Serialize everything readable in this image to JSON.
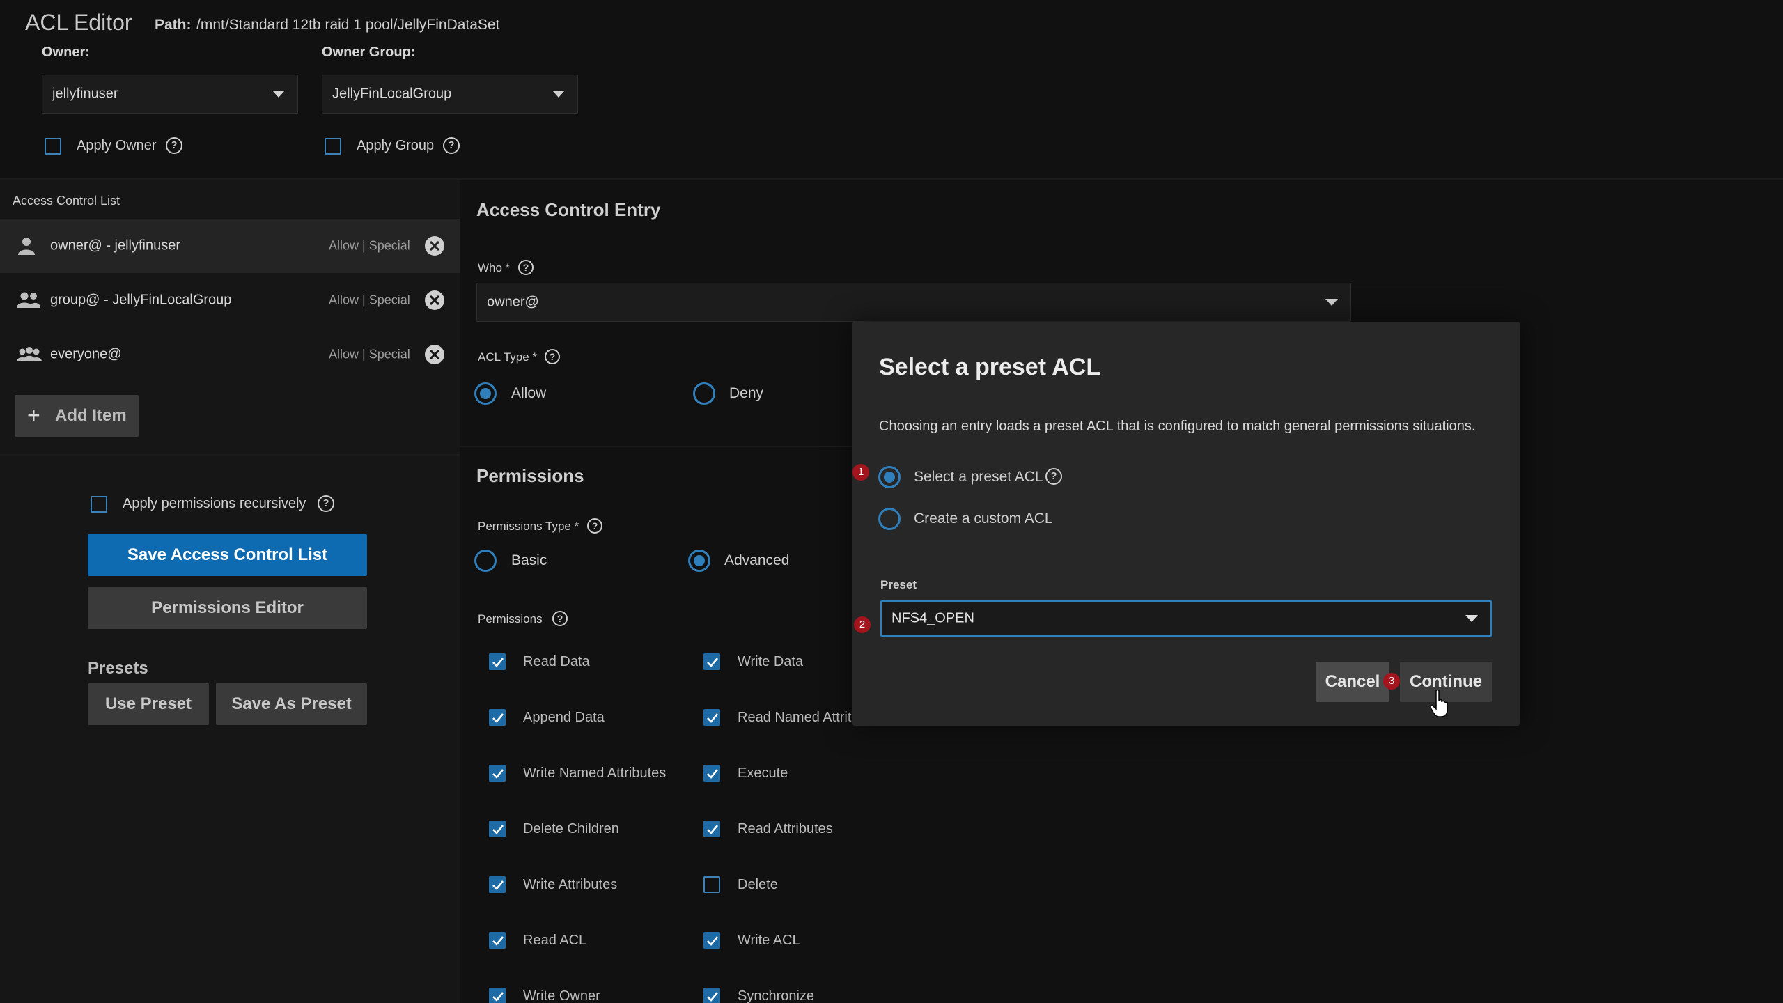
{
  "header": {
    "title": "ACL Editor",
    "path_label": "Path:",
    "path_value": "/mnt/Standard 12tb raid 1 pool/JellyFinDataSet",
    "owner_label": "Owner:",
    "owner_value": "jellyfinuser",
    "owner_group_label": "Owner Group:",
    "owner_group_value": "JellyFinLocalGroup",
    "apply_owner_label": "Apply Owner",
    "apply_owner_checked": false,
    "apply_group_label": "Apply Group",
    "apply_group_checked": false
  },
  "acl_list": {
    "title": "Access Control List",
    "items": [
      {
        "name": "owner@ - jellyfinuser",
        "perm": "Allow | Special",
        "icon": "person-icon",
        "active": true
      },
      {
        "name": "group@ - JellyFinLocalGroup",
        "perm": "Allow | Special",
        "icon": "group-icon",
        "active": false
      },
      {
        "name": "everyone@",
        "perm": "Allow | Special",
        "icon": "everyone-icon",
        "active": false
      }
    ],
    "add_item_label": "Add Item",
    "apply_recursive_label": "Apply permissions recursively",
    "apply_recursive_checked": false,
    "save_label": "Save Access Control List",
    "permissions_editor_label": "Permissions Editor",
    "presets_title": "Presets",
    "use_preset_label": "Use Preset",
    "save_as_preset_label": "Save As Preset"
  },
  "ace": {
    "title": "Access Control Entry",
    "who_label": "Who *",
    "who_value": "owner@",
    "acl_type_label": "ACL Type *",
    "acl_type_options": [
      "Allow",
      "Deny"
    ],
    "acl_type_selected": "Allow",
    "permissions_title": "Permissions",
    "permissions_type_label": "Permissions Type *",
    "permissions_type_options": [
      "Basic",
      "Advanced"
    ],
    "permissions_type_selected": "Advanced",
    "permissions_label": "Permissions",
    "permissions": [
      {
        "label": "Read Data",
        "checked": true
      },
      {
        "label": "Write Data",
        "checked": true
      },
      {
        "label": "Append Data",
        "checked": true
      },
      {
        "label": "Read Named Attrit",
        "checked": true
      },
      {
        "label": "Write Named Attributes",
        "checked": true
      },
      {
        "label": "Execute",
        "checked": true
      },
      {
        "label": "Delete Children",
        "checked": true
      },
      {
        "label": "Read Attributes",
        "checked": true
      },
      {
        "label": "Write Attributes",
        "checked": true
      },
      {
        "label": "Delete",
        "checked": false
      },
      {
        "label": "Read ACL",
        "checked": true
      },
      {
        "label": "Write ACL",
        "checked": true
      },
      {
        "label": "Write Owner",
        "checked": true
      },
      {
        "label": "Synchronize",
        "checked": true
      }
    ]
  },
  "dialog": {
    "title": "Select a preset ACL",
    "description": "Choosing an entry loads a preset ACL that is configured to match general permissions situations.",
    "option_preset_label": "Select a preset ACL",
    "option_custom_label": "Create a custom ACL",
    "selected_option": "Select a preset ACL",
    "preset_label": "Preset",
    "preset_value": "NFS4_OPEN",
    "cancel_label": "Cancel",
    "continue_label": "Continue",
    "badges": [
      "1",
      "2",
      "3"
    ]
  },
  "colors": {
    "accent": "#0f6bb1",
    "radio_blue": "#2f7fbd",
    "badge_red": "#a3141d",
    "background": "#111111"
  }
}
